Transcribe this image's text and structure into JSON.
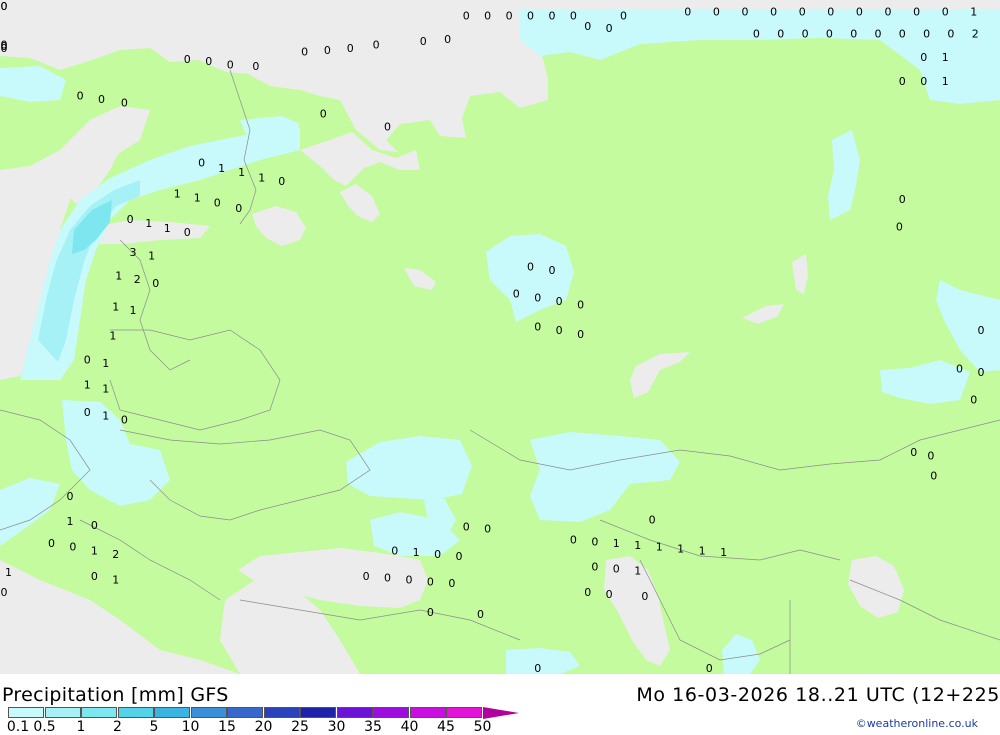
{
  "footer": {
    "title": "Precipitation [mm] GFS",
    "timestamp": "Mo 16-03-2026 18..21 UTC (12+225",
    "credit": "©weatheronline.co.uk"
  },
  "legend": {
    "labels": [
      "0.1",
      "0.5",
      "1",
      "2",
      "5",
      "10",
      "15",
      "20",
      "25",
      "30",
      "35",
      "40",
      "45",
      "50"
    ],
    "colors": [
      "#c8f9fb",
      "#a5f1f6",
      "#7de6ef",
      "#54d3e8",
      "#3ab4e0",
      "#3b8ed8",
      "#3567cc",
      "#2b42bd",
      "#1e22a9",
      "#6b14d8",
      "#9e0ddf",
      "#c90fdf",
      "#e214d8",
      "#b1009b"
    ]
  },
  "map": {
    "colors": {
      "land": "#c5fb9f",
      "sea": "#ececec",
      "precip_light": "#c8f9fb",
      "precip_medium": "#a5f1f6",
      "precip_heavy": "#7de6ef",
      "border": "#8c8c8c"
    },
    "values": [
      {
        "t": "0",
        "lat": 69.2,
        "lon": 29.0
      },
      {
        "t": "0",
        "lat": 69.1,
        "lon": 30.5
      },
      {
        "t": "0",
        "lat": 68.9,
        "lon": 32.0
      },
      {
        "t": "0",
        "lat": 68.8,
        "lon": 33.8
      },
      {
        "t": "0",
        "lat": 69.6,
        "lon": 37.2
      },
      {
        "t": "0",
        "lat": 69.7,
        "lon": 38.8
      },
      {
        "t": "0",
        "lat": 69.8,
        "lon": 40.4
      },
      {
        "t": "0",
        "lat": 70.0,
        "lon": 42.2
      },
      {
        "t": "0",
        "lat": 70.2,
        "lon": 45.5
      },
      {
        "t": "0",
        "lat": 70.3,
        "lon": 47.2
      },
      {
        "t": "0",
        "lat": 71.0,
        "lon": 57.0
      },
      {
        "t": "0",
        "lat": 70.9,
        "lon": 58.5
      },
      {
        "t": "0",
        "lat": 67.2,
        "lon": 21.5
      },
      {
        "t": "0",
        "lat": 67.0,
        "lon": 23.0
      },
      {
        "t": "0",
        "lat": 66.8,
        "lon": 24.6
      },
      {
        "t": "0",
        "lat": 66.2,
        "lon": 38.5
      },
      {
        "t": "0",
        "lat": 65.5,
        "lon": 43.0
      },
      {
        "t": "0",
        "lat": 63.5,
        "lon": 30.0
      },
      {
        "t": "1",
        "lat": 63.2,
        "lon": 31.4
      },
      {
        "t": "1",
        "lat": 63.0,
        "lon": 32.8
      },
      {
        "t": "1",
        "lat": 62.7,
        "lon": 34.2
      },
      {
        "t": "0",
        "lat": 62.5,
        "lon": 35.6
      },
      {
        "t": "1",
        "lat": 61.8,
        "lon": 28.3
      },
      {
        "t": "1",
        "lat": 61.6,
        "lon": 29.7
      },
      {
        "t": "0",
        "lat": 61.3,
        "lon": 31.1
      },
      {
        "t": "0",
        "lat": 61.0,
        "lon": 32.6
      },
      {
        "t": "0",
        "lat": 60.4,
        "lon": 25.0
      },
      {
        "t": "1",
        "lat": 60.2,
        "lon": 26.3
      },
      {
        "t": "1",
        "lat": 59.9,
        "lon": 27.6
      },
      {
        "t": "0",
        "lat": 59.7,
        "lon": 29.0
      },
      {
        "t": "3",
        "lat": 58.6,
        "lon": 25.2
      },
      {
        "t": "1",
        "lat": 58.4,
        "lon": 26.5
      },
      {
        "t": "1",
        "lat": 57.3,
        "lon": 24.2
      },
      {
        "t": "2",
        "lat": 57.1,
        "lon": 25.5
      },
      {
        "t": "0",
        "lat": 56.9,
        "lon": 26.8
      },
      {
        "t": "1",
        "lat": 55.6,
        "lon": 24.0
      },
      {
        "t": "1",
        "lat": 55.4,
        "lon": 25.2
      },
      {
        "t": "1",
        "lat": 54.0,
        "lon": 23.8
      },
      {
        "t": "0",
        "lat": 52.7,
        "lon": 22.0
      },
      {
        "t": "1",
        "lat": 52.5,
        "lon": 23.3
      },
      {
        "t": "1",
        "lat": 51.3,
        "lon": 22.0
      },
      {
        "t": "1",
        "lat": 51.1,
        "lon": 23.3
      },
      {
        "t": "0",
        "lat": 49.8,
        "lon": 22.0
      },
      {
        "t": "1",
        "lat": 49.6,
        "lon": 23.3
      },
      {
        "t": "0",
        "lat": 49.4,
        "lon": 24.6
      },
      {
        "t": "0",
        "lat": 57.8,
        "lon": 53.0
      },
      {
        "t": "0",
        "lat": 57.6,
        "lon": 54.5
      },
      {
        "t": "0",
        "lat": 56.3,
        "lon": 52.0
      },
      {
        "t": "0",
        "lat": 56.1,
        "lon": 53.5
      },
      {
        "t": "0",
        "lat": 55.9,
        "lon": 55.0
      },
      {
        "t": "0",
        "lat": 55.7,
        "lon": 56.5
      },
      {
        "t": "0",
        "lat": 54.5,
        "lon": 53.5
      },
      {
        "t": "0",
        "lat": 54.3,
        "lon": 55.0
      },
      {
        "t": "0",
        "lat": 54.1,
        "lon": 56.5
      },
      {
        "t": "0",
        "lat": 61.5,
        "lon": 79.0
      },
      {
        "t": "0",
        "lat": 60.0,
        "lon": 78.8
      },
      {
        "t": "0",
        "lat": 54.3,
        "lon": 84.5
      },
      {
        "t": "0",
        "lat": 52.2,
        "lon": 83.0
      },
      {
        "t": "0",
        "lat": 52.0,
        "lon": 84.5
      },
      {
        "t": "0",
        "lat": 50.5,
        "lon": 84.0
      },
      {
        "t": "0",
        "lat": 47.6,
        "lon": 79.8
      },
      {
        "t": "0",
        "lat": 47.4,
        "lon": 81.0
      },
      {
        "t": "0",
        "lat": 46.3,
        "lon": 81.2
      },
      {
        "t": "0",
        "lat": 45.2,
        "lon": 20.8
      },
      {
        "t": "1",
        "lat": 43.8,
        "lon": 20.8
      },
      {
        "t": "0",
        "lat": 43.6,
        "lon": 22.5
      },
      {
        "t": "0",
        "lat": 42.6,
        "lon": 19.5
      },
      {
        "t": "0",
        "lat": 42.4,
        "lon": 21.0
      },
      {
        "t": "1",
        "lat": 42.2,
        "lon": 22.5
      },
      {
        "t": "2",
        "lat": 42.0,
        "lon": 24.0
      },
      {
        "t": "1",
        "lat": 41.0,
        "lon": 16.5
      },
      {
        "t": "0",
        "lat": 40.8,
        "lon": 22.5
      },
      {
        "t": "1",
        "lat": 40.6,
        "lon": 24.0
      },
      {
        "t": "0",
        "lat": 39.9,
        "lon": 14.5
      },
      {
        "t": "0",
        "lat": 43.5,
        "lon": 48.5
      },
      {
        "t": "0",
        "lat": 43.4,
        "lon": 50.0
      },
      {
        "t": "0",
        "lat": 42.2,
        "lon": 43.5
      },
      {
        "t": "1",
        "lat": 42.1,
        "lon": 45.0
      },
      {
        "t": "0",
        "lat": 42.0,
        "lon": 46.5
      },
      {
        "t": "0",
        "lat": 41.9,
        "lon": 48.0
      },
      {
        "t": "0",
        "lat": 40.8,
        "lon": 41.5
      },
      {
        "t": "0",
        "lat": 40.7,
        "lon": 43.0
      },
      {
        "t": "0",
        "lat": 40.6,
        "lon": 44.5
      },
      {
        "t": "0",
        "lat": 40.5,
        "lon": 46.0
      },
      {
        "t": "0",
        "lat": 40.4,
        "lon": 47.5
      },
      {
        "t": "0",
        "lat": 38.8,
        "lon": 46.0
      },
      {
        "t": "0",
        "lat": 38.7,
        "lon": 49.5
      },
      {
        "t": "0",
        "lat": 43.9,
        "lon": 61.5
      },
      {
        "t": "0",
        "lat": 42.8,
        "lon": 56.0
      },
      {
        "t": "0",
        "lat": 42.7,
        "lon": 57.5
      },
      {
        "t": "1",
        "lat": 42.6,
        "lon": 59.0
      },
      {
        "t": "1",
        "lat": 42.5,
        "lon": 60.5
      },
      {
        "t": "1",
        "lat": 42.4,
        "lon": 62.0
      },
      {
        "t": "1",
        "lat": 42.3,
        "lon": 63.5
      },
      {
        "t": "1",
        "lat": 42.2,
        "lon": 65.0
      },
      {
        "t": "1",
        "lat": 42.1,
        "lon": 66.5
      },
      {
        "t": "0",
        "lat": 41.3,
        "lon": 57.5
      },
      {
        "t": "0",
        "lat": 41.2,
        "lon": 59.0
      },
      {
        "t": "1",
        "lat": 41.1,
        "lon": 60.5
      },
      {
        "t": "0",
        "lat": 39.9,
        "lon": 57.0
      },
      {
        "t": "0",
        "lat": 39.8,
        "lon": 58.5
      },
      {
        "t": "0",
        "lat": 39.7,
        "lon": 61.0
      },
      {
        "t": "0",
        "lat": 33.5,
        "lon": 53.5
      },
      {
        "t": "0",
        "lat": 33.0,
        "lon": 65.5
      }
    ],
    "edge_values": [
      {
        "t": "0",
        "side": "top",
        "lat": 71.8,
        "lon": 64.0
      },
      {
        "t": "0",
        "side": "top",
        "lat": 71.8,
        "lon": 66.0
      },
      {
        "t": "0",
        "side": "top",
        "lat": 71.8,
        "lon": 68.0
      },
      {
        "t": "0",
        "side": "top",
        "lat": 71.8,
        "lon": 70.0
      },
      {
        "t": "0",
        "side": "top",
        "lat": 71.8,
        "lon": 72.0
      },
      {
        "t": "0",
        "side": "top",
        "lat": 71.8,
        "lon": 74.0
      },
      {
        "t": "0",
        "side": "top",
        "lat": 71.8,
        "lon": 76.0
      },
      {
        "t": "0",
        "side": "top",
        "lat": 71.8,
        "lon": 78.0
      },
      {
        "t": "0",
        "side": "top",
        "lat": 71.8,
        "lon": 80.0
      },
      {
        "t": "0",
        "side": "top",
        "lat": 71.8,
        "lon": 82.0
      },
      {
        "t": "1",
        "side": "top",
        "lat": 71.8,
        "lon": 84.0
      },
      {
        "t": "0",
        "side": "top",
        "lat": 70.6,
        "lon": 68.8
      },
      {
        "t": "0",
        "side": "top",
        "lat": 70.6,
        "lon": 70.5
      },
      {
        "t": "0",
        "side": "top",
        "lat": 70.6,
        "lon": 72.2
      },
      {
        "t": "0",
        "side": "top",
        "lat": 70.6,
        "lon": 73.9
      },
      {
        "t": "0",
        "side": "top",
        "lat": 70.6,
        "lon": 75.6
      },
      {
        "t": "0",
        "side": "top",
        "lat": 70.6,
        "lon": 77.3
      },
      {
        "t": "0",
        "side": "top",
        "lat": 70.6,
        "lon": 79.0
      },
      {
        "t": "0",
        "side": "top",
        "lat": 70.6,
        "lon": 80.7
      },
      {
        "t": "0",
        "side": "top",
        "lat": 70.6,
        "lon": 82.4
      },
      {
        "t": "2",
        "side": "top",
        "lat": 70.6,
        "lon": 84.1
      },
      {
        "t": "0",
        "side": "top",
        "lat": 69.3,
        "lon": 80.5
      },
      {
        "t": "1",
        "side": "top",
        "lat": 69.3,
        "lon": 82.0
      },
      {
        "t": "0",
        "side": "top",
        "lat": 68.0,
        "lon": 79.0
      },
      {
        "t": "0",
        "side": "top",
        "lat": 68.0,
        "lon": 80.5
      },
      {
        "t": "1",
        "side": "top",
        "lat": 68.0,
        "lon": 82.0
      },
      {
        "t": "0",
        "side": "top",
        "lat": 71.6,
        "lon": 48.5
      },
      {
        "t": "0",
        "side": "top",
        "lat": 71.6,
        "lon": 50.0
      },
      {
        "t": "0",
        "side": "top",
        "lat": 71.6,
        "lon": 51.5
      },
      {
        "t": "0",
        "side": "top",
        "lat": 71.6,
        "lon": 53.0
      },
      {
        "t": "0",
        "side": "top",
        "lat": 71.6,
        "lon": 54.5
      },
      {
        "t": "0",
        "side": "top",
        "lat": 71.6,
        "lon": 56.0
      },
      {
        "t": "0",
        "side": "top",
        "lat": 71.6,
        "lon": 59.5
      },
      {
        "t": "0",
        "side": "top",
        "lat": 72.2,
        "lon": 14.0
      },
      {
        "t": "0",
        "side": "top",
        "lat": 72.2,
        "lon": 16.0
      },
      {
        "t": "0",
        "side": "top",
        "lat": 70.0,
        "lon": 13.0
      },
      {
        "t": "0",
        "side": "top",
        "lat": 69.9,
        "lon": 14.3
      },
      {
        "t": "0",
        "side": "top",
        "lat": 69.8,
        "lon": 15.6
      }
    ]
  }
}
